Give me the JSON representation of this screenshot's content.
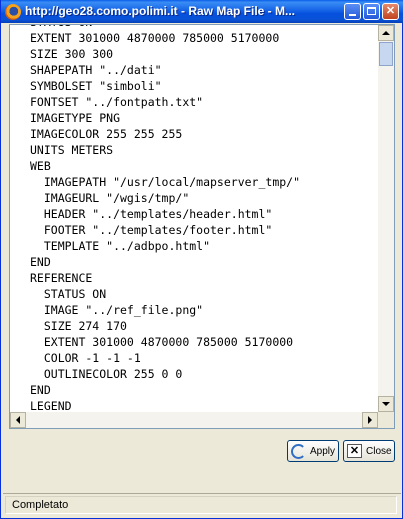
{
  "window": {
    "title": "http://geo28.como.polimi.it - Raw Map File - M...",
    "title_icon": "firefox-logo-icon"
  },
  "controls": {
    "minimize_icon": "minimize-icon",
    "maximize_icon": "maximize-icon",
    "close_icon": "close-x-icon"
  },
  "code": {
    "lines": [
      "STATUS ON",
      "EXTENT 301000 4870000 785000 5170000",
      "SIZE 300 300",
      "SHAPEPATH \"../dati\"",
      "SYMBOLSET \"simboli\"",
      "FONTSET \"../fontpath.txt\"",
      "IMAGETYPE PNG",
      "IMAGECOLOR 255 255 255",
      "UNITS METERS",
      "WEB",
      "  IMAGEPATH \"/usr/local/mapserver_tmp/\"",
      "  IMAGEURL \"/wgis/tmp/\"",
      "  HEADER \"../templates/header.html\"",
      "  FOOTER \"../templates/footer.html\"",
      "  TEMPLATE \"../adbpo.html\"",
      "END",
      "REFERENCE",
      "  STATUS ON",
      "  IMAGE \"../ref_file.png\"",
      "  SIZE 274 170",
      "  EXTENT 301000 4870000 785000 5170000",
      "  COLOR -1 -1 -1",
      "  OUTLINECOLOR 255 0 0",
      "END",
      "LEGEND"
    ]
  },
  "buttons": {
    "apply_label": "Apply",
    "apply_icon": "apply-refresh-icon",
    "close_label": "Close",
    "close_icon": "close-box-icon"
  },
  "status": {
    "text": "Completato"
  },
  "colors": {
    "titlebar": "#0a53d6",
    "window_bg": "#ece9d8",
    "border": "#0831d9"
  }
}
